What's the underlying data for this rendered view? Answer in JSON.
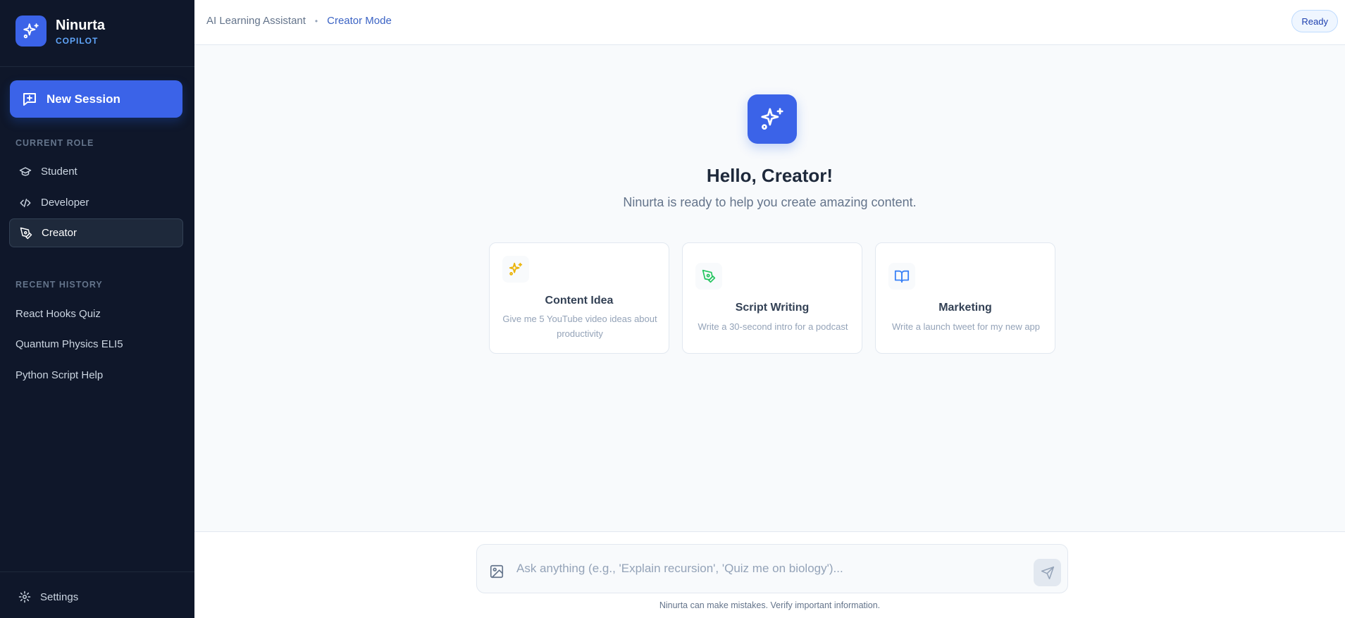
{
  "brand": {
    "name": "Ninurta",
    "subtitle": "COPILOT",
    "logo_icon": "sparkles-icon"
  },
  "sidebar": {
    "new_session_label": "New Session",
    "current_role_title": "CURRENT ROLE",
    "roles": [
      {
        "label": "Student",
        "icon": "graduation-cap-icon",
        "active": false
      },
      {
        "label": "Developer",
        "icon": "code-icon",
        "active": false
      },
      {
        "label": "Creator",
        "icon": "pen-tool-icon",
        "active": true
      }
    ],
    "recent_history_title": "RECENT HISTORY",
    "history": [
      {
        "label": "React Hooks Quiz"
      },
      {
        "label": "Quantum Physics ELI5"
      },
      {
        "label": "Python Script Help"
      }
    ],
    "settings_label": "Settings"
  },
  "header": {
    "breadcrumb_app": "AI Learning Assistant",
    "breadcrumb_separator": "•",
    "breadcrumb_mode": "Creator Mode",
    "status": "Ready"
  },
  "main": {
    "greeting": "Hello, Creator!",
    "subtitle": "Ninurta is ready to help you create amazing content.",
    "cards": [
      {
        "title": "Content Idea",
        "description": "Give me 5 YouTube video ideas about productivity",
        "icon": "sparkles-icon",
        "icon_color": "#eab308"
      },
      {
        "title": "Script Writing",
        "description": "Write a 30-second intro for a podcast",
        "icon": "pen-tool-icon",
        "icon_color": "#22c55e"
      },
      {
        "title": "Marketing",
        "description": "Write a launch tweet for my new app",
        "icon": "book-open-icon",
        "icon_color": "#3b82f6"
      }
    ]
  },
  "composer": {
    "placeholder": "Ask anything (e.g., 'Explain recursion', 'Quiz me on biology')...",
    "value": "",
    "disclaimer": "Ninurta can make mistakes. Verify important information."
  },
  "colors": {
    "accent": "#3b63e8",
    "sidebar_bg": "#0f172a",
    "page_bg": "#f8fafc"
  }
}
